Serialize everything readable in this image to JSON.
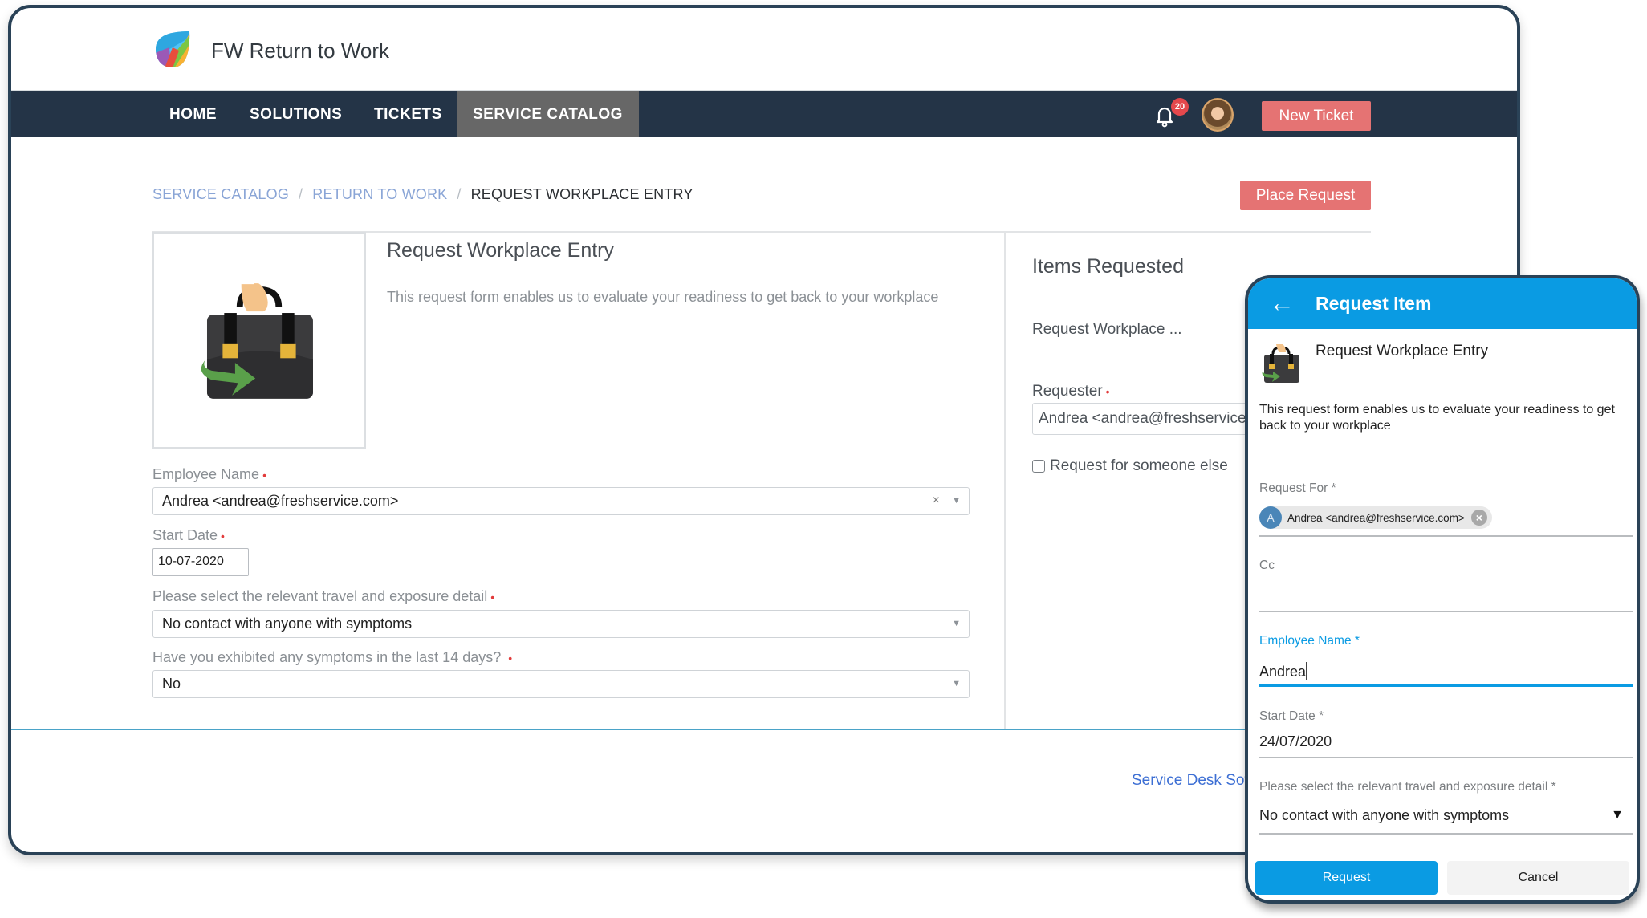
{
  "app": {
    "title": "FW Return to Work",
    "logo_icon": "freshservice-logo-icon"
  },
  "nav": {
    "items": [
      {
        "label": "HOME",
        "active": false
      },
      {
        "label": "SOLUTIONS",
        "active": false
      },
      {
        "label": "TICKETS",
        "active": false
      },
      {
        "label": "SERVICE CATALOG",
        "active": true
      }
    ],
    "notifications_count": "20",
    "new_ticket_label": "New Ticket"
  },
  "breadcrumb": {
    "items": [
      "SERVICE CATALOG",
      "RETURN TO WORK"
    ],
    "current": "REQUEST WORKPLACE ENTRY",
    "separator": "/"
  },
  "place_request_label": "Place Request",
  "form": {
    "title": "Request Workplace Entry",
    "description": "This request form enables us to evaluate your readiness to get back to your workplace",
    "required_marker": "•",
    "fields": {
      "employee_name": {
        "label": "Employee Name",
        "value": "Andrea <andrea@freshservice.com>",
        "clear": "×"
      },
      "start_date": {
        "label": "Start Date",
        "value": "10-07-2020"
      },
      "travel": {
        "label": "Please select the relevant travel and exposure detail",
        "value": "No contact with anyone with symptoms"
      },
      "symptoms": {
        "label": "Have you exhibited any symptoms in the last 14 days?",
        "value": "No"
      }
    },
    "caret": "▼"
  },
  "items_panel": {
    "title": "Items Requested",
    "item": "Request Workplace ...",
    "requester_label": "Requester",
    "requester_value": "Andrea <andrea@freshservice.com>",
    "someone_else_label": "Request for someone else"
  },
  "footer": {
    "link": "Service Desk Software"
  },
  "mobile": {
    "back": "←",
    "title": "Request Item",
    "item_title": "Request Workplace Entry",
    "description": "This request form enables us to evaluate your readiness to get back to your workplace",
    "request_for": {
      "label": "Request For *",
      "chip_initial": "A",
      "chip_text": "Andrea <andrea@freshservice.com>",
      "chip_remove": "×"
    },
    "cc": {
      "label": "Cc",
      "value": ""
    },
    "employee_name": {
      "label": "Employee Name *",
      "value": "Andrea"
    },
    "start_date": {
      "label": "Start Date *",
      "value": "24/07/2020"
    },
    "travel": {
      "label": "Please select the relevant travel and exposure detail *",
      "value": "No contact with anyone with symptoms",
      "caret": "▼"
    },
    "request_label": "Request",
    "cancel_label": "Cancel"
  },
  "colors": {
    "nav_bg": "#243447",
    "nav_active": "#676767",
    "button_red": "#e57373",
    "mobile_blue": "#0a9be3",
    "frame": "#2a4257",
    "link": "#3d6fd4"
  }
}
